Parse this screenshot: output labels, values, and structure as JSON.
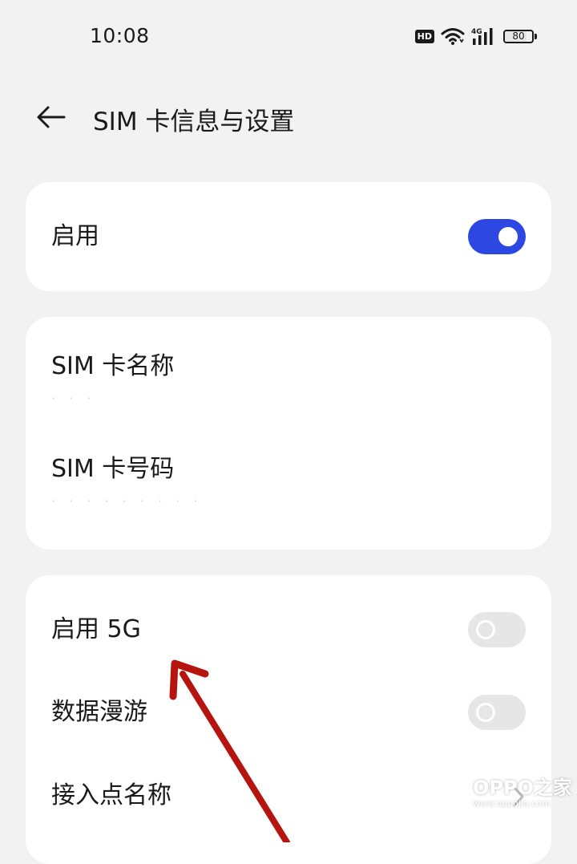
{
  "status_bar": {
    "time": "10:08",
    "hd_label": "HD",
    "network_label": "4G",
    "battery_level": "80",
    "battery_fraction": 0.8
  },
  "header": {
    "title": "SIM 卡信息与设置",
    "icon": "arrow-left-icon"
  },
  "card_enable": {
    "label": "启用",
    "toggle_on": true,
    "accent_color": "#2d47e3"
  },
  "card_sim_info": {
    "name_label": "SIM 卡名称",
    "name_value": "· · ·",
    "number_label": "SIM 卡号码",
    "number_value": "· · · · · · · · ·"
  },
  "card_network": {
    "enable_5g_label": "启用 5G",
    "enable_5g_on": false,
    "data_roaming_label": "数据漫游",
    "data_roaming_on": false,
    "apn_label": "接入点名称",
    "apn_icon": "chevron-right-icon"
  },
  "annotation": {
    "color": "#b5140f",
    "icon": "red-arrow-annotation"
  },
  "watermark": {
    "main_text": "OPPO之家",
    "url_text": "www.oppojia.com"
  }
}
